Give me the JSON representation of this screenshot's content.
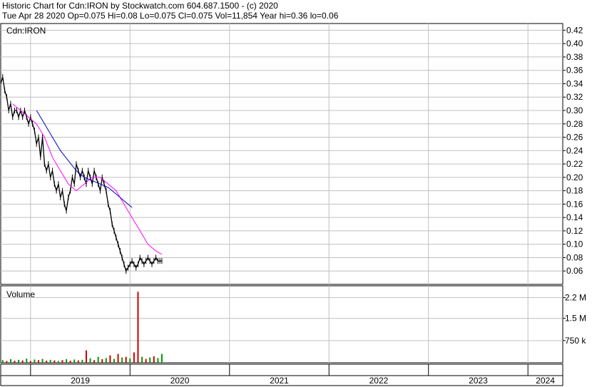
{
  "header": {
    "line1": "Historic Chart for Cdn:IRON by Stockwatch.com 604.687.1500 - (c) 2020",
    "line2": "Tue Apr 28 2020  Op=0.075  Hi=0.08  Lo=0.075  Cl=0.075  Vol=11,854  Year hi=0.36  lo=0.06"
  },
  "chart_data": [
    {
      "type": "line",
      "panel": "price",
      "title": "Cdn:IRON",
      "grid": true,
      "ylim": [
        0.04,
        0.43
      ],
      "y_ticks": [
        "0.42",
        "0.40",
        "0.38",
        "0.36",
        "0.34",
        "0.32",
        "0.30",
        "0.28",
        "0.26",
        "0.24",
        "0.22",
        "0.20",
        "0.18",
        "0.16",
        "0.14",
        "0.12",
        "0.10",
        "0.08",
        "0.06"
      ],
      "x_ticks": [
        "2019",
        "2020",
        "2021",
        "2022",
        "2023",
        "2024"
      ],
      "xlim": [
        2018.7,
        2024.35
      ],
      "colors": {
        "price": "#000000",
        "ma_short": "#ff00ff",
        "ma_long": "#0000cc",
        "grid": "#c0c0c0"
      },
      "series": [
        {
          "role": "price",
          "x": [
            2018.7,
            2018.72,
            2018.74,
            2018.76,
            2018.78,
            2018.8,
            2018.82,
            2018.84,
            2018.86,
            2018.88,
            2018.9,
            2018.92,
            2018.94,
            2018.96,
            2018.98,
            2019.0,
            2019.02,
            2019.04,
            2019.06,
            2019.08,
            2019.1,
            2019.12,
            2019.14,
            2019.16,
            2019.18,
            2019.2,
            2019.22,
            2019.24,
            2019.26,
            2019.28,
            2019.3,
            2019.32,
            2019.34,
            2019.36,
            2019.38,
            2019.4,
            2019.42,
            2019.44,
            2019.46,
            2019.48,
            2019.5,
            2019.52,
            2019.54,
            2019.56,
            2019.58,
            2019.6,
            2019.62,
            2019.64,
            2019.66,
            2019.68,
            2019.7,
            2019.72,
            2019.74,
            2019.76,
            2019.78,
            2019.8,
            2019.82,
            2019.84,
            2019.86,
            2019.88,
            2019.9,
            2019.92,
            2019.94,
            2019.96,
            2019.98,
            2020.0,
            2020.02,
            2020.04,
            2020.06,
            2020.08,
            2020.1,
            2020.12,
            2020.14,
            2020.16,
            2020.18,
            2020.2,
            2020.22,
            2020.24,
            2020.26,
            2020.28,
            2020.3,
            2020.32
          ],
          "close": [
            0.34,
            0.35,
            0.33,
            0.32,
            0.3,
            0.31,
            0.29,
            0.3,
            0.3,
            0.29,
            0.3,
            0.29,
            0.3,
            0.29,
            0.28,
            0.29,
            0.28,
            0.27,
            0.25,
            0.26,
            0.23,
            0.26,
            0.22,
            0.21,
            0.22,
            0.2,
            0.21,
            0.19,
            0.18,
            0.19,
            0.17,
            0.18,
            0.16,
            0.15,
            0.17,
            0.18,
            0.2,
            0.19,
            0.22,
            0.21,
            0.2,
            0.21,
            0.2,
            0.19,
            0.21,
            0.2,
            0.19,
            0.21,
            0.2,
            0.19,
            0.18,
            0.2,
            0.19,
            0.18,
            0.16,
            0.15,
            0.13,
            0.12,
            0.11,
            0.1,
            0.09,
            0.08,
            0.07,
            0.06,
            0.065,
            0.07,
            0.075,
            0.07,
            0.065,
            0.07,
            0.08,
            0.075,
            0.07,
            0.075,
            0.08,
            0.075,
            0.07,
            0.075,
            0.08,
            0.075,
            0.075,
            0.075
          ]
        },
        {
          "role": "ma_short",
          "x": [
            2018.82,
            2018.9,
            2018.98,
            2019.06,
            2019.14,
            2019.22,
            2019.3,
            2019.38,
            2019.46,
            2019.54,
            2019.62,
            2019.7,
            2019.78,
            2019.86,
            2019.94,
            2020.02,
            2020.1,
            2020.18,
            2020.26,
            2020.32
          ],
          "values": [
            0.31,
            0.3,
            0.29,
            0.28,
            0.26,
            0.23,
            0.21,
            0.19,
            0.18,
            0.19,
            0.2,
            0.2,
            0.19,
            0.18,
            0.16,
            0.14,
            0.12,
            0.1,
            0.09,
            0.085
          ]
        },
        {
          "role": "ma_long",
          "x": [
            2019.06,
            2019.14,
            2019.22,
            2019.3,
            2019.38,
            2019.46,
            2019.54,
            2019.62,
            2019.7,
            2019.78,
            2019.86,
            2019.94,
            2020.02
          ],
          "values": [
            0.3,
            0.28,
            0.26,
            0.24,
            0.225,
            0.21,
            0.2,
            0.195,
            0.19,
            0.185,
            0.175,
            0.165,
            0.155
          ]
        }
      ]
    },
    {
      "type": "bar",
      "panel": "volume",
      "title": "Volume",
      "y_ticks": [
        "2.2 M",
        "1.5 M",
        "750 k"
      ],
      "y_tick_values": [
        2200000,
        1500000,
        750000
      ],
      "ylim": [
        0,
        2600000
      ],
      "colors": {
        "up": "#009900",
        "down": "#cc0000"
      },
      "bars": [
        {
          "x": 2018.72,
          "v": 90000,
          "d": "up"
        },
        {
          "x": 2018.76,
          "v": 60000,
          "d": "down"
        },
        {
          "x": 2018.8,
          "v": 120000,
          "d": "up"
        },
        {
          "x": 2018.84,
          "v": 70000,
          "d": "down"
        },
        {
          "x": 2018.88,
          "v": 100000,
          "d": "up"
        },
        {
          "x": 2018.92,
          "v": 80000,
          "d": "down"
        },
        {
          "x": 2018.96,
          "v": 140000,
          "d": "up"
        },
        {
          "x": 2019.0,
          "v": 60000,
          "d": "down"
        },
        {
          "x": 2019.04,
          "v": 110000,
          "d": "up"
        },
        {
          "x": 2019.08,
          "v": 90000,
          "d": "down"
        },
        {
          "x": 2019.12,
          "v": 130000,
          "d": "up"
        },
        {
          "x": 2019.16,
          "v": 70000,
          "d": "down"
        },
        {
          "x": 2019.2,
          "v": 100000,
          "d": "up"
        },
        {
          "x": 2019.24,
          "v": 80000,
          "d": "down"
        },
        {
          "x": 2019.28,
          "v": 60000,
          "d": "up"
        },
        {
          "x": 2019.32,
          "v": 90000,
          "d": "down"
        },
        {
          "x": 2019.36,
          "v": 120000,
          "d": "up"
        },
        {
          "x": 2019.4,
          "v": 70000,
          "d": "down"
        },
        {
          "x": 2019.44,
          "v": 110000,
          "d": "up"
        },
        {
          "x": 2019.48,
          "v": 80000,
          "d": "down"
        },
        {
          "x": 2019.52,
          "v": 100000,
          "d": "up"
        },
        {
          "x": 2019.56,
          "v": 420000,
          "d": "down"
        },
        {
          "x": 2019.6,
          "v": 150000,
          "d": "up"
        },
        {
          "x": 2019.64,
          "v": 90000,
          "d": "down"
        },
        {
          "x": 2019.68,
          "v": 200000,
          "d": "up"
        },
        {
          "x": 2019.72,
          "v": 120000,
          "d": "down"
        },
        {
          "x": 2019.76,
          "v": 160000,
          "d": "up"
        },
        {
          "x": 2019.8,
          "v": 250000,
          "d": "down"
        },
        {
          "x": 2019.84,
          "v": 130000,
          "d": "up"
        },
        {
          "x": 2019.88,
          "v": 300000,
          "d": "down"
        },
        {
          "x": 2019.92,
          "v": 180000,
          "d": "up"
        },
        {
          "x": 2019.96,
          "v": 200000,
          "d": "down"
        },
        {
          "x": 2020.0,
          "v": 150000,
          "d": "up"
        },
        {
          "x": 2020.04,
          "v": 350000,
          "d": "down"
        },
        {
          "x": 2020.08,
          "v": 2400000,
          "d": "down"
        },
        {
          "x": 2020.12,
          "v": 200000,
          "d": "up"
        },
        {
          "x": 2020.16,
          "v": 130000,
          "d": "down"
        },
        {
          "x": 2020.2,
          "v": 180000,
          "d": "up"
        },
        {
          "x": 2020.24,
          "v": 220000,
          "d": "down"
        },
        {
          "x": 2020.28,
          "v": 160000,
          "d": "up"
        },
        {
          "x": 2020.32,
          "v": 300000,
          "d": "up"
        }
      ]
    }
  ]
}
